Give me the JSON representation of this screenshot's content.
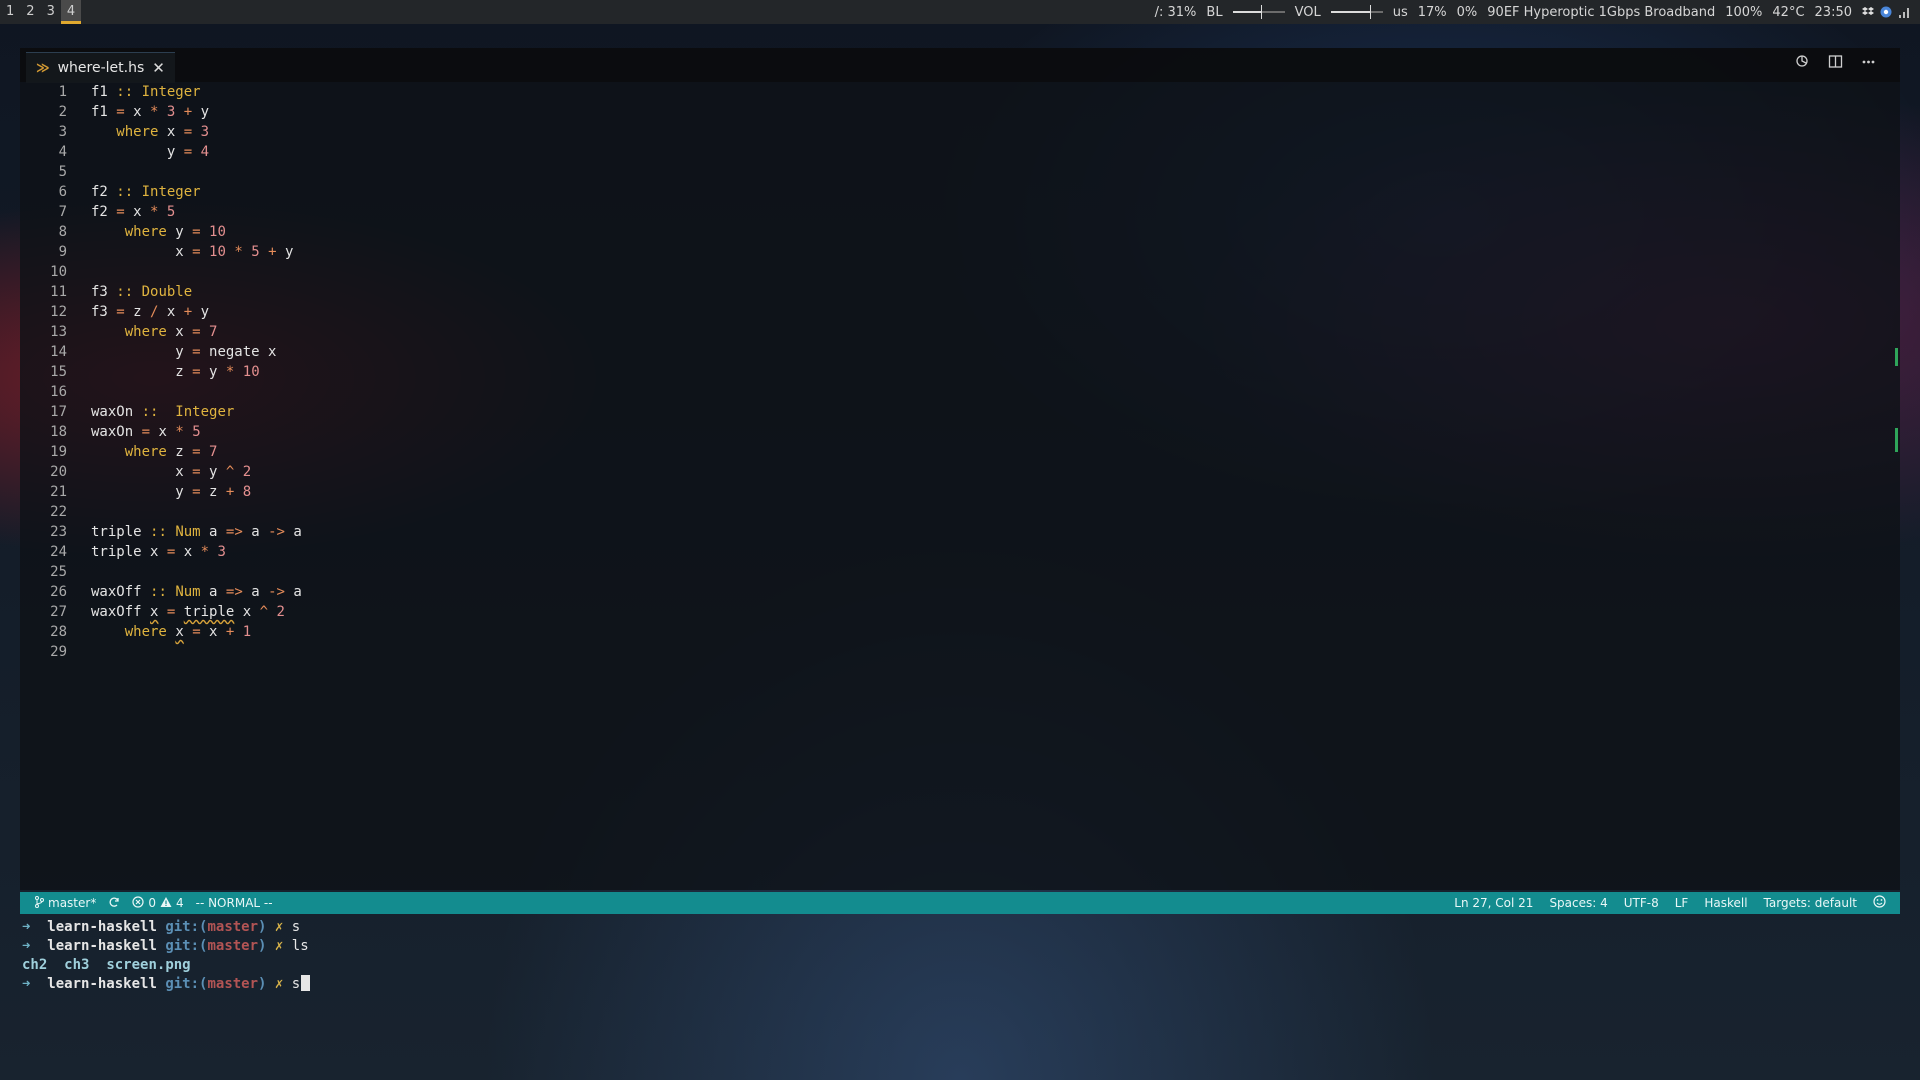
{
  "topbar": {
    "workspaces": [
      "1",
      "2",
      "3",
      "4"
    ],
    "active_workspace": "4",
    "storage_percent": "/: 31%",
    "backlight_label": "BL",
    "backlight_level": 0.55,
    "volume_label": "VOL",
    "volume_level": 0.75,
    "keyboard_layout": "us",
    "cpu_percent": "17%",
    "mem_percent": "0%",
    "network_name": "90EF Hyperoptic 1Gbps Broadband",
    "battery_percent": "100%",
    "temperature": "42°C",
    "clock": "23:50",
    "tray_icons": [
      "dropbox-icon",
      "browser-icon",
      "wifi-icon"
    ]
  },
  "editor": {
    "tab_title": "where-let.hs",
    "tab_icon": "haskell-icon",
    "actions": [
      "open-changes-icon",
      "split-editor-icon",
      "more-actions-icon"
    ],
    "lines": [
      "f1 :: Integer",
      "f1 = x * 3 + y",
      "   where x = 3",
      "         y = 4",
      "",
      "f2 :: Integer",
      "f2 = x * 5",
      "    where y = 10",
      "          x = 10 * 5 + y",
      "",
      "f3 :: Double",
      "f3 = z / x + y",
      "    where x = 7",
      "          y = negate x",
      "          z = y * 10",
      "",
      "waxOn ::  Integer",
      "waxOn = x * 5",
      "    where z = 7",
      "          x = y ^ 2",
      "          y = z + 8",
      "",
      "triple :: Num a => a -> a",
      "triple x = x * 3",
      "",
      "waxOff :: Num a => a -> a",
      "waxOff x = triple x ^ 2",
      "    where x = x + 1",
      ""
    ]
  },
  "statusbar": {
    "branch": "master*",
    "errors": "0",
    "warnings": "4",
    "vim_mode": "-- NORMAL --",
    "cursor_position": "Ln 27, Col 21",
    "indentation": "Spaces: 4",
    "encoding": "UTF-8",
    "line_ending": "LF",
    "language": "Haskell",
    "targets": "Targets: default"
  },
  "terminal": {
    "prompt_arrow": "➜",
    "cwd": "learn-haskell",
    "git_prefix": "git:(",
    "branch": "master",
    "git_suffix": ")",
    "dirty_mark": "✗",
    "commands": [
      "s",
      "ls",
      "s"
    ],
    "ls_output": [
      "ch2",
      "ch3",
      "screen.png"
    ]
  }
}
